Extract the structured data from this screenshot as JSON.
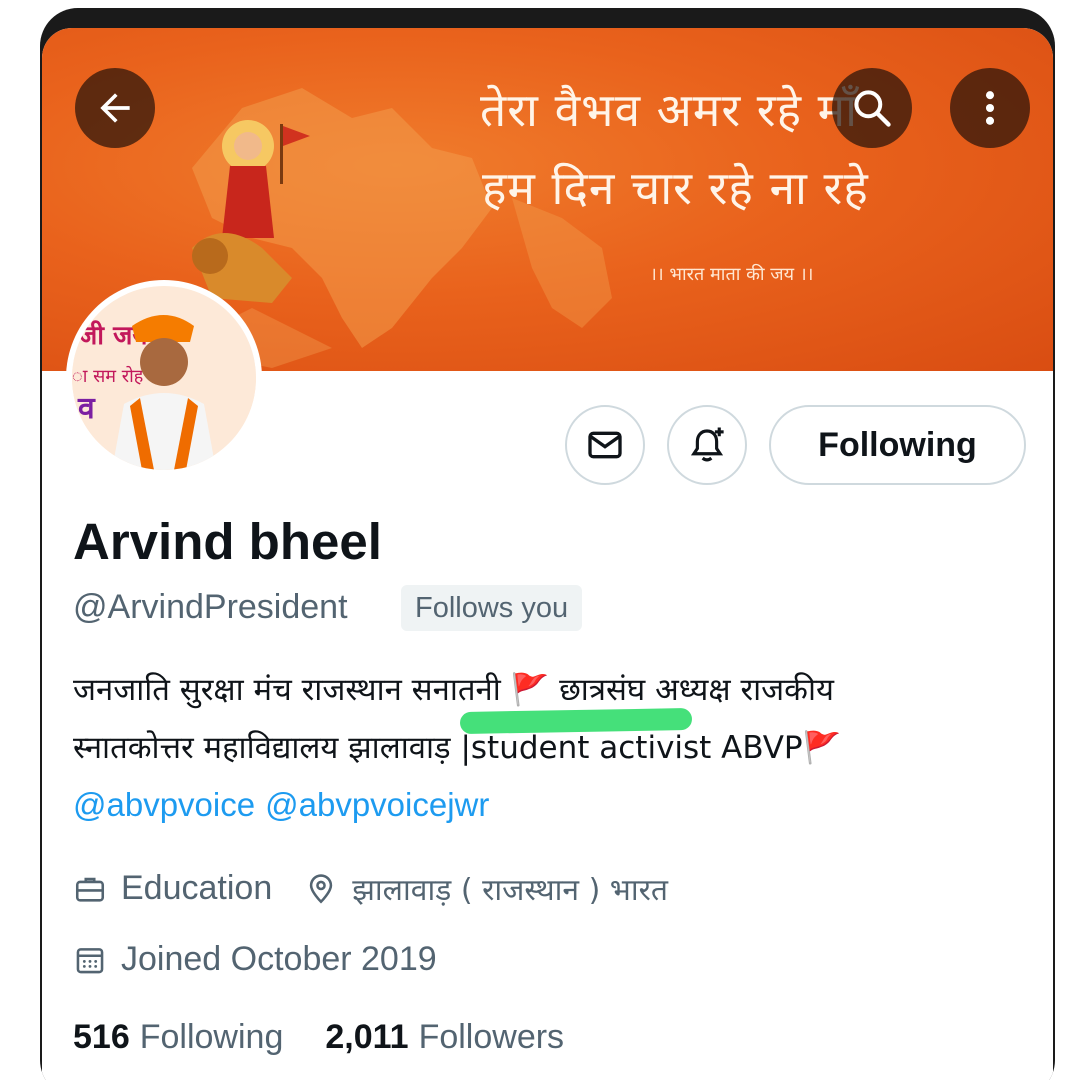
{
  "banner": {
    "line1": "तेरा वैभव अमर रहे माँ",
    "line2": "हम दिन चार रहे ना रहे",
    "line3": "।। भारत माता की जय ।।"
  },
  "avatar": {
    "text_top": "जी जय",
    "text_mid": "ा सम रोह",
    "text_left": "व"
  },
  "actions": {
    "following_label": "Following"
  },
  "profile": {
    "name": "Arvind bheel",
    "handle": "@ArvindPresident",
    "follows_you": "Follows you",
    "bio_line1_a": "जनजाति सुरक्षा मंच राजस्थान  सनातनी ",
    "bio_flag": "🚩",
    "bio_line1_b": " छात्रसंघ अध्यक्ष राजकीय",
    "bio_line2_a": "स्नातकोत्तर महाविद्यालय झालावाड़ |student activist ABVP",
    "mentions": [
      "@abvpvoice",
      "@abvpvoicejwr"
    ],
    "category": "Education",
    "location": "झालावाड़ ( राजस्थान ) भारत",
    "joined": "Joined October 2019"
  },
  "stats": {
    "following_count": "516",
    "following_label": "Following",
    "followers_count": "2,011",
    "followers_label": "Followers"
  },
  "icons": [
    "back-arrow-icon",
    "search-icon",
    "more-vertical-icon",
    "mail-icon",
    "bell-plus-icon",
    "briefcase-icon",
    "location-pin-icon",
    "calendar-icon"
  ],
  "colors": {
    "banner": "#e9621c",
    "link": "#1d9bf0",
    "secondary_text": "#536471",
    "highlight": "#45e07a"
  }
}
